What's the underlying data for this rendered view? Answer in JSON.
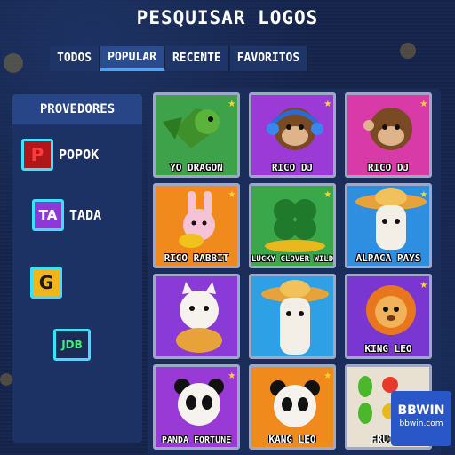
{
  "page": {
    "title": "PESQUISAR LOGOS"
  },
  "tabs": [
    {
      "label": "TODOS",
      "active": false
    },
    {
      "label": "POPULAR",
      "active": true
    },
    {
      "label": "RECENTE",
      "active": false
    },
    {
      "label": "FAVORITOS",
      "active": false
    }
  ],
  "sidebar": {
    "header": "PROVEDORES",
    "providers": [
      {
        "label": "POPOK",
        "icon": "popok-logo-icon",
        "glyph": "P",
        "color": "#ff3b3b",
        "bg": "#b0161a"
      },
      {
        "label": "TADA",
        "icon": "tada-logo-icon",
        "glyph": "TA",
        "color": "#ffffff",
        "bg": "#8c3ad6"
      },
      {
        "label": "",
        "icon": "g-logo-icon",
        "glyph": "G",
        "color": "#1a1a1a",
        "bg": "#f2b51c"
      },
      {
        "label": "",
        "icon": "jdb-logo-icon",
        "glyph": "JDB",
        "color": "#3cf07a",
        "bg": "#1d2b57"
      }
    ]
  },
  "games": [
    {
      "label": "YO DRAGON",
      "starred": true,
      "bg": "#3ea24a",
      "icon": "dragon-icon"
    },
    {
      "label": "RICO DJ",
      "starred": true,
      "bg": "#9b3ad6",
      "icon": "monkey-dj-icon"
    },
    {
      "label": "RICO DJ",
      "starred": true,
      "bg": "#d83aa8",
      "icon": "monkey-icon"
    },
    {
      "label": "RICO RABBIT",
      "starred": true,
      "bg": "#f08a1c",
      "icon": "rabbit-icon"
    },
    {
      "label": "LUCKY CLOVER WILD",
      "starred": true,
      "bg": "#3aa84a",
      "icon": "clover-icon"
    },
    {
      "label": "ALPACA PAYS",
      "starred": true,
      "bg": "#2e8fe0",
      "icon": "alpaca-icon"
    },
    {
      "label": "",
      "starred": false,
      "bg": "#8a3ad6",
      "icon": "panda-cat-icon"
    },
    {
      "label": "",
      "starred": false,
      "bg": "#2ea0e6",
      "icon": "alpaca-sombrero-icon"
    },
    {
      "label": "KING LEO",
      "starred": true,
      "bg": "#7a36d0",
      "icon": "lion-icon"
    },
    {
      "label": "PANDA FORTUNE",
      "starred": true,
      "bg": "#9a3ad6",
      "icon": "panda-icon"
    },
    {
      "label": "KANG LEO",
      "starred": true,
      "bg": "#f08a1c",
      "icon": "panda-leo-icon"
    },
    {
      "label": "FRUITY",
      "starred": false,
      "bg": "#e8e0d0",
      "icon": "fruit-icon"
    }
  ],
  "brand": {
    "name": "BBWIN",
    "site": "bbwin.com"
  }
}
